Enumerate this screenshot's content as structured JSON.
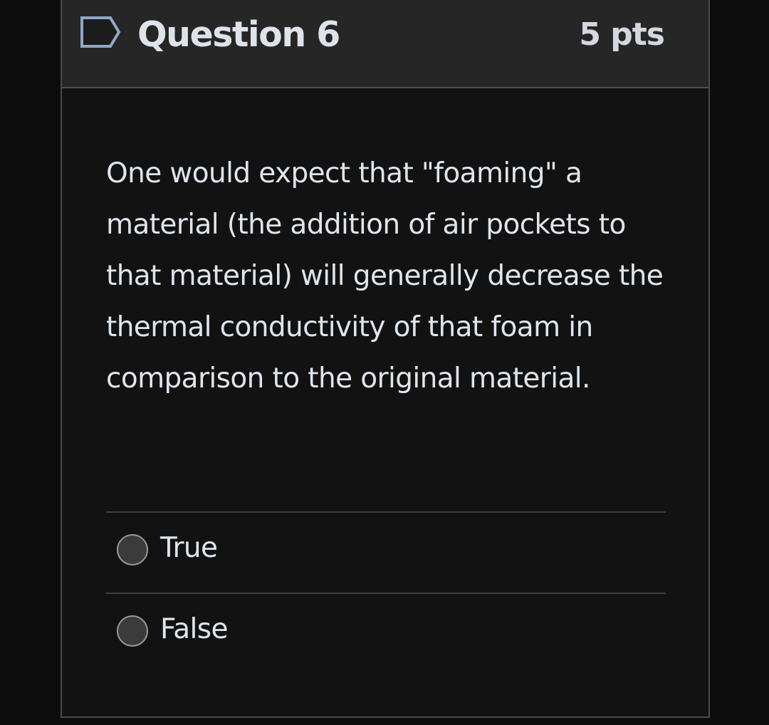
{
  "question": {
    "title": "Question 6",
    "points": "5 pts",
    "flag_icon": "flag-outline-icon",
    "text": "One would expect that \"foaming\" a material (the addition of air pockets to that material) will generally decrease the thermal conductivity of that foam in comparison to the original material."
  },
  "answers": [
    {
      "label": "True",
      "selected": false
    },
    {
      "label": "False",
      "selected": false
    }
  ],
  "colors": {
    "page_background": "#0c0c0c",
    "header_background": "#262626",
    "card_background": "#121212",
    "text": "#dfe5ec",
    "border": "#4a4a4a",
    "flag_fill": "#1c1c1c",
    "flag_accent": "#8ea8c8",
    "radio_fill": "#3b3b3b",
    "radio_border": "#9a9a9a"
  }
}
